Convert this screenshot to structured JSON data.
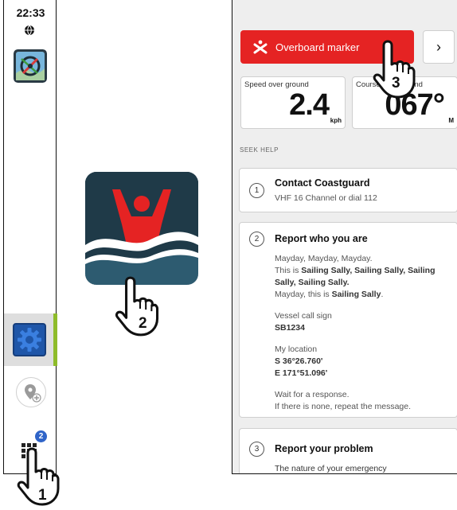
{
  "sidebar": {
    "time": "22:33",
    "notification_count": "2"
  },
  "panel": {
    "overboard_label": "Overboard marker",
    "next_label": "›",
    "sog_label": "Speed over ground",
    "sog_value": "2.4",
    "sog_unit": "kph",
    "course_label": "Course over ground",
    "course_value": "067°",
    "course_unit": "M",
    "seek_help": "SEEK HELP",
    "steps": [
      {
        "num": "1",
        "title": "Contact Coastguard",
        "text": "VHF 16 Channel or dial 112"
      },
      {
        "num": "2",
        "title": "Report who you are",
        "mayday_1": "Mayday, Mayday, Mayday.",
        "mayday_2_prefix": "This is ",
        "vessel_repeat": "Sailing Sally, Sailing Sally, Sailing Sally, Sailing Sally",
        "mayday_3_prefix": "Mayday, this is ",
        "vessel_name": "Sailing Sally",
        "call_sign_label": "Vessel call sign",
        "call_sign": "SB1234",
        "location_label": "My location",
        "lat": "S 36°26.760'",
        "lon": "E 171°51.096'",
        "wait_1": "Wait for a response.",
        "wait_2": "If there is none, repeat the message."
      },
      {
        "num": "3",
        "title": "Report your problem",
        "subtitle": "The nature of your emergency"
      }
    ]
  },
  "callouts": {
    "step_1": "1",
    "step_2": "2",
    "step_3": "3"
  },
  "colors": {
    "overboard_red": "#e52323",
    "accent_green": "#8ebc2a",
    "settings_blue": "#1f56a8",
    "mob_background": "#1f3a48",
    "mob_figure": "#e52323"
  },
  "icons": {
    "sidebar": [
      "globe-icon",
      "chart-app-icon",
      "settings-gear-icon",
      "add-waypoint-icon",
      "apps-grid-icon"
    ],
    "center": "man-overboard-app-icon",
    "panel": [
      "overboard-x-icon",
      "chevron-right-icon"
    ]
  }
}
